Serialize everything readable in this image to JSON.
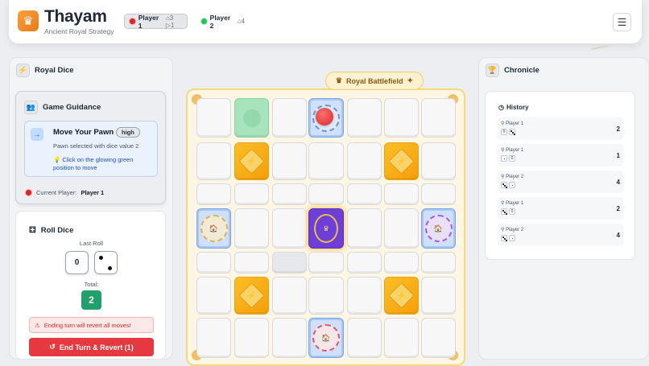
{
  "header": {
    "title": "Thayam",
    "subtitle": "Ancient Royal Strategy",
    "players": [
      {
        "name": "Player 1",
        "stats": "⌂3 ▷1",
        "color": "#dc2626",
        "active": true
      },
      {
        "name": "Player 2",
        "stats": "⌂4",
        "color": "#22c55e",
        "active": false
      }
    ],
    "menu_icon": "hamburger-menu-icon"
  },
  "dice_panel": {
    "title": "Royal Dice",
    "guidance": {
      "title": "Game Guidance",
      "tip_title": "Move Your Pawn",
      "priority": "high",
      "tip_sub": "Pawn selected with dice value 2",
      "tip_hint": "💡 Click on the glowing green position to move",
      "current_label": "Current Player:",
      "current_player": "Player 1"
    },
    "roll": {
      "title": "Roll Dice",
      "last_roll_label": "Last Roll",
      "dice": [
        0,
        3
      ],
      "total_label": "Total:",
      "total": "2",
      "warning": "Ending turn will revert all moves!",
      "end_button": "End Turn & Revert (1)"
    }
  },
  "board": {
    "title": "Royal Battlefield",
    "legend_colors": {
      "player1": "#dc2626",
      "player2": "#22c55e",
      "rosette": "#f59e0b",
      "center": "#6d3fd8"
    }
  },
  "chronicle": {
    "title": "Chronicle",
    "history_title": "History",
    "entries": [
      {
        "player": "Player 1",
        "dice": [
          "0",
          "3"
        ],
        "total": "2"
      },
      {
        "player": "Player 1",
        "dice": [
          "1",
          "0"
        ],
        "total": "1"
      },
      {
        "player": "Player 2",
        "dice": [
          "3",
          "1"
        ],
        "total": "4"
      },
      {
        "player": "Player 1",
        "dice": [
          "3",
          "0"
        ],
        "total": "2"
      },
      {
        "player": "Player 2",
        "dice": [
          "3",
          "1"
        ],
        "total": "4"
      }
    ]
  }
}
